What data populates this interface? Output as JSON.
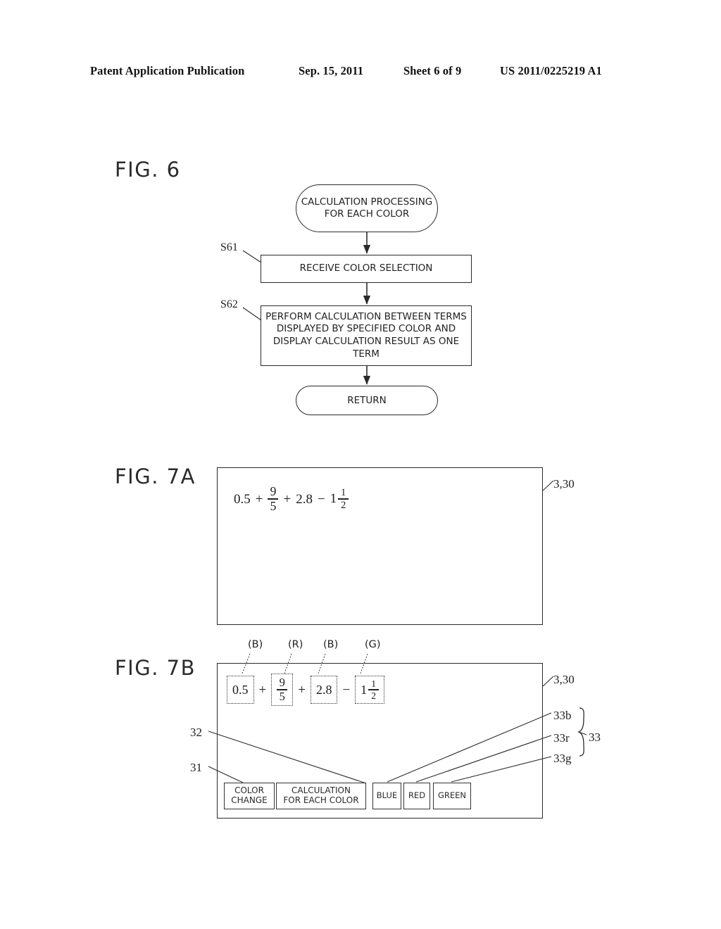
{
  "header": {
    "publication": "Patent Application Publication",
    "date": "Sep. 15, 2011",
    "sheet": "Sheet 6 of 9",
    "number": "US 2011/0225219 A1"
  },
  "figures": {
    "fig6": {
      "title": "FIG. 6",
      "nodes": {
        "start": "CALCULATION PROCESSING FOR EACH COLOR",
        "s61": "RECEIVE COLOR SELECTION",
        "s62": "PERFORM CALCULATION BETWEEN TERMS DISPLAYED BY SPECIFIED COLOR AND DISPLAY CALCULATION RESULT AS ONE TERM",
        "end": "RETURN"
      },
      "step_labels": {
        "s61": "S61",
        "s62": "S62"
      }
    },
    "fig7a": {
      "title": "FIG. 7A",
      "reference": "3,30",
      "expression": {
        "terms": [
          {
            "kind": "number",
            "value": "0.5"
          },
          {
            "kind": "operator",
            "value": "+"
          },
          {
            "kind": "fraction",
            "numerator": "9",
            "denominator": "5"
          },
          {
            "kind": "operator",
            "value": "+"
          },
          {
            "kind": "number",
            "value": "2.8"
          },
          {
            "kind": "operator",
            "value": "−"
          },
          {
            "kind": "mixed",
            "whole": "1",
            "numerator": "1",
            "denominator": "2"
          }
        ]
      }
    },
    "fig7b": {
      "title": "FIG. 7B",
      "reference": "3,30",
      "expression": {
        "terms": [
          {
            "kind": "number",
            "value": "0.5",
            "color_tag": "(B)"
          },
          {
            "kind": "operator",
            "value": "+"
          },
          {
            "kind": "fraction",
            "numerator": "9",
            "denominator": "5",
            "color_tag": "(R)"
          },
          {
            "kind": "operator",
            "value": "+"
          },
          {
            "kind": "number",
            "value": "2.8",
            "color_tag": "(B)"
          },
          {
            "kind": "operator",
            "value": "−"
          },
          {
            "kind": "mixed",
            "whole": "1",
            "numerator": "1",
            "denominator": "2",
            "color_tag": "(G)"
          }
        ]
      },
      "color_tags": [
        "(B)",
        "(R)",
        "(B)",
        "(G)"
      ],
      "buttons": {
        "color_change": "COLOR CHANGE",
        "color_change_line1": "COLOR",
        "color_change_line2": "CHANGE",
        "calculation_each_color": "CALCULATION FOR EACH COLOR",
        "calculation_line1": "CALCULATION",
        "calculation_line2": "FOR EACH COLOR",
        "blue": "BLUE",
        "red": "RED",
        "green": "GREEN"
      },
      "references": {
        "panel": "3,30",
        "color_change_btn": "31",
        "calc_btn": "32",
        "blue_btn": "33b",
        "red_btn": "33r",
        "green_btn": "33g",
        "group": "33"
      }
    }
  }
}
